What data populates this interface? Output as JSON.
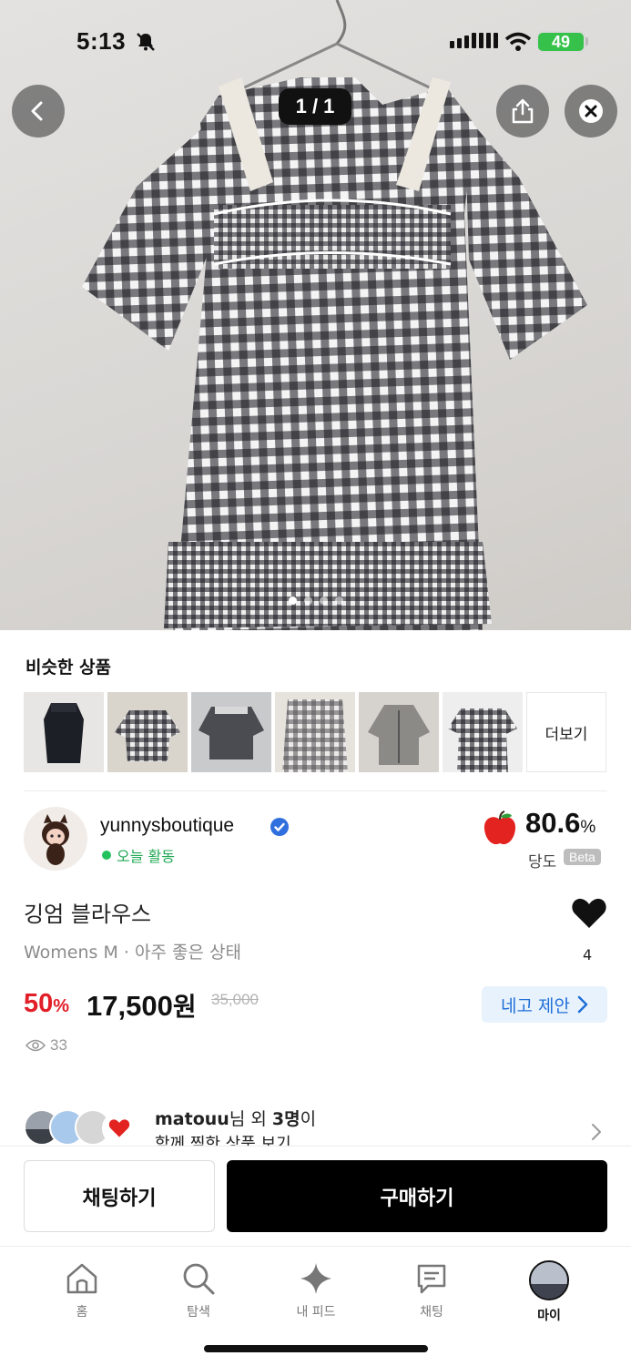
{
  "status_bar": {
    "time": "5:13",
    "battery": "49"
  },
  "gallery": {
    "counter": "1 / 1",
    "page_dots": 4,
    "active_dot": 0
  },
  "similar": {
    "title": "비슷한 상품",
    "more_label": "더보기"
  },
  "seller": {
    "name": "yunnysboutique",
    "activity": "오늘 활동",
    "rating_value": "80.6",
    "rating_unit": "%",
    "rating_label": "당도",
    "beta_label": "Beta"
  },
  "product": {
    "title": "깅엄 블라우스",
    "subtitle": "Womens M · 아주 좋은 상태",
    "likes": "4",
    "discount_value": "50",
    "discount_unit": "%",
    "price_value": "17,500",
    "price_unit": "원",
    "original_price": "35,000",
    "offer_label": "네고 제안",
    "views": "33"
  },
  "watchers": {
    "name": "matouu",
    "suffix_1": "님 외 ",
    "count": "3명",
    "suffix_2": "이",
    "sub": "함께 찜한 상품 보기"
  },
  "actions": {
    "chat_label": "채팅하기",
    "buy_label": "구매하기"
  },
  "tabs": [
    {
      "label": "홈",
      "icon": "home-icon"
    },
    {
      "label": "탐색",
      "icon": "search-icon"
    },
    {
      "label": "내 피드",
      "icon": "sparkle-icon"
    },
    {
      "label": "채팅",
      "icon": "chat-icon"
    },
    {
      "label": "마이",
      "icon": "profile-avatar"
    }
  ],
  "colors": {
    "discount": "#e21e27",
    "offer": "#1f6fd8",
    "active_green": "#21c25b",
    "verified": "#2f6fde"
  }
}
